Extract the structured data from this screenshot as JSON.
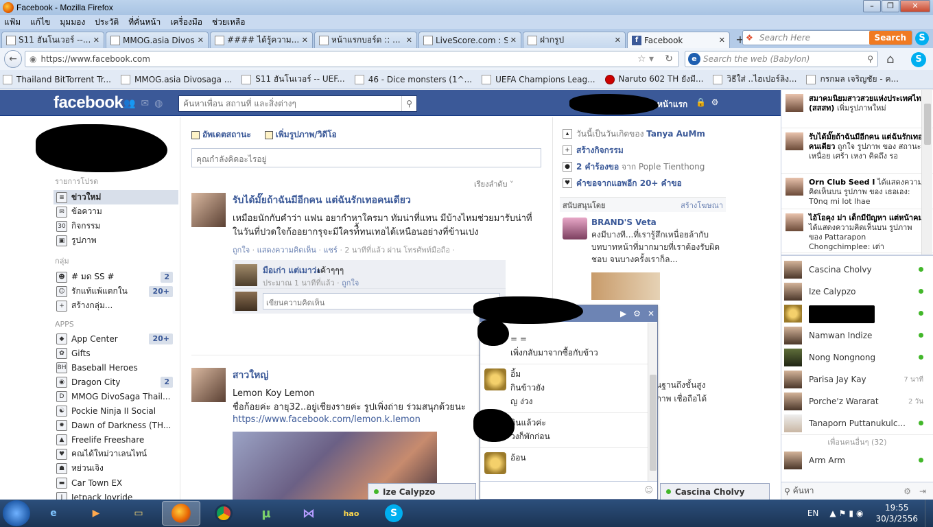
{
  "window": {
    "title": "Facebook - Mozilla Firefox"
  },
  "menubar": {
    "items": [
      "แฟ้ม",
      "แก้ไข",
      "มุมมอง",
      "ประวัติ",
      "ที่คั่นหน้า",
      "เครื่องมือ",
      "ช่วยเหลือ"
    ]
  },
  "tabs": [
    {
      "label": "S11 ฮันโนเวอร์ --..."
    },
    {
      "label": "MMOG.asia Divos..."
    },
    {
      "label": "#### ได้รู้ความ..."
    },
    {
      "label": "หน้าแรกบอร์ด :: ..."
    },
    {
      "label": "LiveScore.com : S..."
    },
    {
      "label": "ฝากรูป"
    },
    {
      "label": "Facebook",
      "active": true
    }
  ],
  "firefox_search": {
    "placeholder": "Search Here",
    "button": "Search"
  },
  "navbar": {
    "url": "https://www.facebook.com",
    "babylon_placeholder": "Search the web (Babylon)"
  },
  "bookmarks": [
    "Thailand BitTorrent Tr...",
    "MMOG.asia Divosaga ...",
    "S11 ฮันโนเวอร์ -- UEF...",
    "46 - Dice monsters (1^...",
    "UEFA Champions Leag...",
    "Naruto 602 TH ยังมี...",
    "วิธีใส่ ..ไฮเปอร์ลิง...",
    "กรกมล เจริญชัย - ค..."
  ],
  "fb": {
    "logo": "facebook",
    "search_placeholder": "ค้นหาเพื่อน สถานที่ และสิ่งต่างๆ",
    "home_label": "หน้าแรก",
    "left": {
      "favorites_title": "รายการโปรด",
      "favorites": [
        {
          "icon": "news-feed-icon",
          "label": "ข่าวใหม่",
          "selected": true
        },
        {
          "icon": "messages-icon",
          "label": "ข้อความ"
        },
        {
          "icon": "events-icon",
          "label": "กิจกรรม"
        },
        {
          "icon": "photos-icon",
          "label": "รูปภาพ"
        }
      ],
      "groups_title": "กลุ่ม",
      "groups": [
        {
          "label": "# มด SS #",
          "count": "2"
        },
        {
          "label": "รักแท้แพ้แดกใน",
          "count": "20+"
        },
        {
          "label": "สร้างกลุ่ม..."
        }
      ],
      "apps_title": "APPS",
      "apps": [
        {
          "label": "App Center",
          "count": "20+"
        },
        {
          "label": "Gifts"
        },
        {
          "label": "Baseball Heroes"
        },
        {
          "label": "Dragon City",
          "count": "2"
        },
        {
          "label": "MMOG DivoSaga Thail..."
        },
        {
          "label": "Pockie Ninja II Social"
        },
        {
          "label": "Dawn of Darkness (TH..."
        },
        {
          "label": "Freelife Freeshare"
        },
        {
          "label": "คณได้ใหม่วาเลนไทน์"
        },
        {
          "label": "หย่วนเจิง"
        },
        {
          "label": "Car Town EX"
        },
        {
          "label": "Jetpack Joyride"
        }
      ]
    },
    "composer": {
      "status_tab": "อัพเดตสถานะ",
      "photo_tab": "เพิ่มรูปภาพ/วิดีโอ",
      "placeholder": "คุณกำลังคิดอะไรอยู่"
    },
    "sort_label": "เรียงลำดับ ˅",
    "story1": {
      "title": "รับได้มั๊ยถ้าฉันมีอีกคน แต่ฉันรักเทอคนเดียว",
      "text": "เหมือยนักกับคำว่า แฟน อยากำหาใครมา ทัมน่าที่แทน มีบ้างไหมช่วยมารับน่าที่ ในวันที่ปวดใจก้ออยากรุจะมีใครท์ื้ทนเทอได้เหนือนอย่างที่ข้านเปง",
      "meta_like": "ถูกใจ",
      "meta_comment": "แสดงความคิดเห็น",
      "meta_share": "แชร์",
      "meta_time": "· 2 นาทีที่แล้ว ผ่าน โทรศัพท์มือถือ ·",
      "comment": {
        "name": "มือเก่า แต่เมาว่ะ",
        "text": "เค้าๆๆๆ",
        "meta": "ประมาณ 1 นาทีที่แล้ว ·",
        "like": "ถูกใจ"
      },
      "write_placeholder": "เขียนความคิดเห็น"
    },
    "story2": {
      "title": "สาวใหญ่",
      "line1": "Lemon Koy Lemon",
      "line2": "ชื่อก้อยค่ะ อายุ32..อยู่เชียงรายค่ะ รูปเพิ่งถ่าย ร่วมสนุกด้วยนะ",
      "link": "https://www.facebook.com/lemon.k.lemon"
    },
    "right": {
      "birthday": "วันนี้เป็นวันเกิดของ",
      "birthday_name": "Tanya AuMm",
      "create_event": "สร้างกิจกรรม",
      "requests_count": "2 คำร้องขอ",
      "requests_from": "จาก Pople Tienthong",
      "app_requests": "คำขอจากแอพอีก 20+ คำขอ",
      "sponsored": "สนับสนุนโดย",
      "create_ad": "สร้างโฆษณา",
      "ad_title": "BRAND'S Veta",
      "ad_text": "คงมีบางที...ที่เรารู้สึกเหนื่อยล้ากับบทบาทหน้าที่มากมายที่เราต้องรับผิดชอบ จนบางครั้งเราก็ล...",
      "ad_snippet": "นฐานถึงขั้นสูง ภาพ เชื่อถือได้"
    },
    "chat": {
      "messages": [
        {
          "lines": [
            "= =",
            "เพิ่งกลับมาจากซื้อกับข้าว"
          ]
        },
        {
          "lines": [
            "อิ้ม",
            "กินข้าวยัง",
            "ญ ง่วง"
          ]
        },
        {
          "lines": [
            "กินแล้วค่ะ",
            "วงก็พักก่อน"
          ]
        },
        {
          "lines": [
            "อ้อน"
          ]
        }
      ]
    },
    "chat_tabs": [
      "Ize Calypzo",
      "Cascina Cholvy"
    ]
  },
  "sidebar": {
    "ticker": [
      {
        "bold": "สมาคมนิยมสาวสวยแห่งประเทศไทย (สสสท)",
        "rest": " เพิ่มรูปภาพใหม่"
      },
      {
        "bold": "รับได้มั๊ยถ้าฉันมีอีกคน แต่ฉันรักเทอคนเดียว",
        "rest": " ถูกใจ รูปภาพ ของ สถานะ เหนื่อย เศร้า เหงา คิดถึง รอ"
      },
      {
        "bold": "Orn Club Seed I",
        "rest": " ได้แสดงความคิดเห็นบน รูปภาพ ของ เธอเอง: T0nq mi lot lhae"
      },
      {
        "bold": "ไอ้โอคุง ม่า เด็กมีปัญหา แต่หน้าคม",
        "rest": " ได้แสดงความคิดเห็นบน รูปภาพ ของ Pattarapon Chongchimplee: เต่า"
      }
    ],
    "friends": [
      {
        "name": "Cascina Cholvy",
        "status": "online"
      },
      {
        "name": "Ize Calypzo",
        "status": "online"
      },
      {
        "name": "",
        "status": "online"
      },
      {
        "name": "Namwan Indize",
        "status": "online"
      },
      {
        "name": "Nong Nongnong",
        "status": "online"
      },
      {
        "name": "Parisa Jay Kay",
        "ago": "7 นาที"
      },
      {
        "name": "Porche'z Wararat",
        "ago": "2 วัน"
      },
      {
        "name": "Tanaporn Puttanukulc...",
        "status": "online"
      }
    ],
    "more_friends": "เพื่อนคนอื่นๆ (32)",
    "more_first": {
      "name": "Arm Arm",
      "status": "online"
    },
    "search_placeholder": "ค้นหา"
  },
  "taskbar": {
    "lang": "EN",
    "time": "19:55",
    "date": "30/3/2556",
    "apps": [
      "ie-icon",
      "media-player-icon",
      "explorer-icon",
      "firefox-icon",
      "chrome-icon",
      "utorrent-icon",
      "vs-icon",
      "hao123-icon",
      "skype-icon"
    ]
  }
}
